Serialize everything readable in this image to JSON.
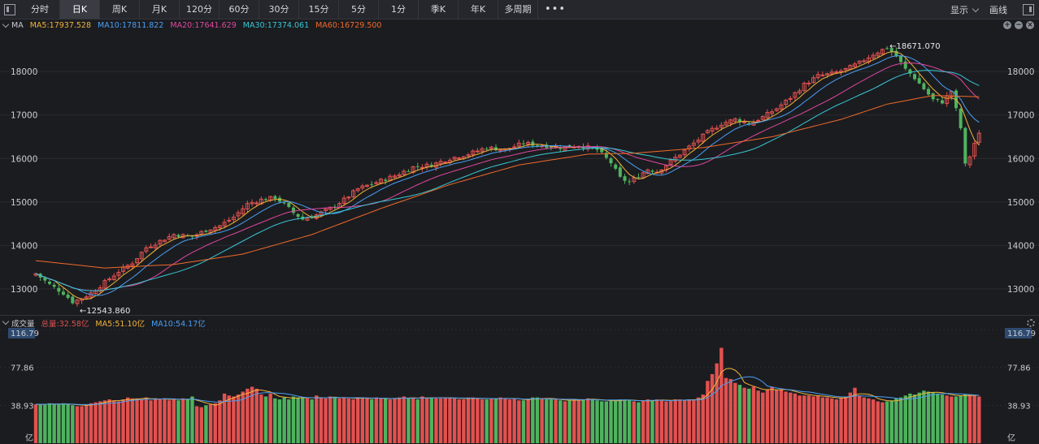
{
  "toolbar": {
    "tabs": [
      "分时",
      "日K",
      "周K",
      "月K",
      "120分",
      "60分",
      "30分",
      "15分",
      "5分",
      "1分",
      "季K",
      "年K",
      "多周期"
    ],
    "active_tab": "日K",
    "more": "•••",
    "display_label": "显示",
    "draw_label": "画线"
  },
  "price_legend": {
    "label": "MA",
    "ma5": "MA5:17937.528",
    "ma10": "MA10:17811.822",
    "ma20": "MA20:17641.629",
    "ma30": "MA30:17374.061",
    "ma60": "MA60:16729.500"
  },
  "volume_legend": {
    "label": "成交量",
    "total": "总量:32.58亿",
    "ma5": "MA5:51.10亿",
    "ma10": "MA10:54.17亿"
  },
  "colors": {
    "up": "#e2514f",
    "down": "#4fb35e",
    "ma5": "#f0b43a",
    "ma10": "#4a9ff5",
    "ma20": "#e0479e",
    "ma30": "#38c7d4",
    "ma60": "#f06a2a",
    "background": "#1b1c20",
    "grid": "#2a2b30"
  },
  "chart_data": [
    {
      "type": "candlestick",
      "yticks": [
        13000,
        14000,
        15000,
        16000,
        17000,
        18000
      ],
      "ylim": [
        12400,
        18900
      ],
      "grid": true,
      "annotations": {
        "max": "18671.070",
        "min": "12543.860"
      },
      "anchors_close": [
        [
          0,
          13350
        ],
        [
          3,
          13100
        ],
        [
          6,
          12900
        ],
        [
          8,
          12700
        ],
        [
          10,
          12780
        ],
        [
          12,
          12900
        ],
        [
          15,
          13150
        ],
        [
          18,
          13400
        ],
        [
          21,
          13600
        ],
        [
          24,
          13950
        ],
        [
          27,
          14100
        ],
        [
          30,
          14250
        ],
        [
          34,
          14200
        ],
        [
          37,
          14350
        ],
        [
          40,
          14450
        ],
        [
          43,
          14650
        ],
        [
          46,
          14950
        ],
        [
          49,
          15050
        ],
        [
          52,
          15100
        ],
        [
          54,
          14950
        ],
        [
          56,
          14750
        ],
        [
          58,
          14600
        ],
        [
          61,
          14700
        ],
        [
          64,
          14850
        ],
        [
          67,
          15050
        ],
        [
          70,
          15300
        ],
        [
          74,
          15450
        ],
        [
          78,
          15600
        ],
        [
          82,
          15800
        ],
        [
          86,
          15850
        ],
        [
          90,
          16000
        ],
        [
          94,
          16100
        ],
        [
          98,
          16250
        ],
        [
          102,
          16200
        ],
        [
          106,
          16350
        ],
        [
          110,
          16300
        ],
        [
          114,
          16250
        ],
        [
          118,
          16300
        ],
        [
          122,
          16200
        ],
        [
          125,
          15900
        ],
        [
          127,
          15550
        ],
        [
          129,
          15450
        ],
        [
          131,
          15600
        ],
        [
          133,
          15750
        ],
        [
          135,
          15700
        ],
        [
          137,
          15850
        ],
        [
          140,
          16100
        ],
        [
          143,
          16350
        ],
        [
          146,
          16600
        ],
        [
          149,
          16800
        ],
        [
          152,
          16900
        ],
        [
          155,
          16800
        ],
        [
          158,
          16950
        ],
        [
          161,
          17150
        ],
        [
          164,
          17400
        ],
        [
          167,
          17700
        ],
        [
          170,
          17900
        ],
        [
          173,
          17950
        ],
        [
          176,
          18050
        ],
        [
          179,
          18200
        ],
        [
          182,
          18400
        ],
        [
          185,
          18550
        ],
        [
          187,
          18350
        ],
        [
          189,
          18050
        ],
        [
          191,
          17850
        ],
        [
          193,
          17600
        ],
        [
          195,
          17350
        ],
        [
          197,
          17300
        ],
        [
          199,
          17550
        ],
        [
          201,
          16700
        ],
        [
          202,
          15850
        ],
        [
          203,
          16050
        ],
        [
          204,
          16350
        ],
        [
          205,
          16550
        ]
      ],
      "ma60_anchors": [
        [
          0,
          13650
        ],
        [
          15,
          13480
        ],
        [
          30,
          13560
        ],
        [
          45,
          13800
        ],
        [
          60,
          14250
        ],
        [
          75,
          14850
        ],
        [
          90,
          15400
        ],
        [
          105,
          15850
        ],
        [
          120,
          16100
        ],
        [
          130,
          16120
        ],
        [
          145,
          16250
        ],
        [
          160,
          16500
        ],
        [
          175,
          16900
        ],
        [
          185,
          17250
        ],
        [
          195,
          17450
        ],
        [
          205,
          17420
        ]
      ]
    },
    {
      "type": "bar",
      "ylabel": "亿",
      "yticks": [
        "38.93",
        "77.86",
        "116.79"
      ],
      "ylim": [
        0,
        116.79
      ],
      "total_bars": 206,
      "values": [
        40,
        40,
        40,
        41,
        40,
        40,
        41,
        40,
        39,
        38,
        38,
        40,
        41,
        42,
        43,
        44,
        45,
        44,
        43,
        45,
        47,
        46,
        46,
        45,
        47,
        44,
        46,
        45,
        46,
        44,
        46,
        44,
        46,
        45,
        48,
        38,
        37,
        39,
        40,
        41,
        44,
        51,
        49,
        48,
        50,
        53,
        56,
        58,
        56,
        50,
        48,
        51,
        46,
        45,
        47,
        45,
        48,
        47,
        47,
        46,
        45,
        49,
        47,
        46,
        48,
        47,
        46,
        47,
        46,
        45,
        47,
        47,
        46,
        45,
        47,
        46,
        46,
        45,
        46,
        47,
        48,
        46,
        46,
        45,
        48,
        47,
        47,
        46,
        46,
        47,
        47,
        46,
        45,
        45,
        47,
        47,
        46,
        45,
        45,
        46,
        46,
        47,
        46,
        45,
        46,
        44,
        44,
        45,
        47,
        47,
        46,
        45,
        45,
        45,
        44,
        43,
        44,
        45,
        45,
        45,
        46,
        45,
        44,
        43,
        43,
        44,
        44,
        45,
        45,
        44,
        43,
        42,
        44,
        45,
        44,
        45,
        44,
        43,
        44,
        45,
        45,
        44,
        45,
        44,
        47,
        50,
        64,
        71,
        82,
        98,
        67,
        66,
        62,
        60,
        57,
        56,
        58,
        54,
        52,
        55,
        58,
        55,
        55,
        53,
        52,
        51,
        49,
        49,
        49,
        48,
        49,
        47,
        47,
        46,
        45,
        47,
        48,
        52,
        57,
        49,
        47,
        46,
        45,
        43,
        42,
        43,
        44,
        46,
        47,
        49,
        51,
        50,
        52,
        54,
        53,
        52,
        51,
        50,
        49,
        48,
        48,
        49,
        50,
        50,
        49,
        48
      ],
      "series": [
        {
          "name": "MA5",
          "value": "51.10亿"
        },
        {
          "name": "MA10",
          "value": "54.17亿"
        }
      ]
    }
  ]
}
